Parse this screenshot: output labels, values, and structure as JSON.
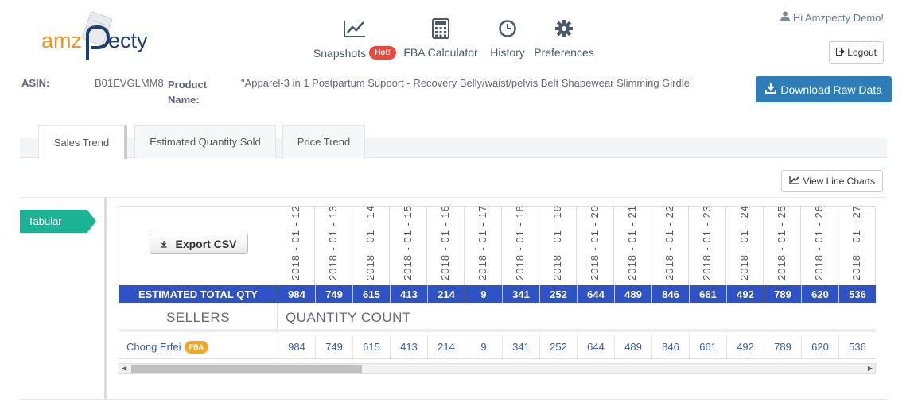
{
  "logo": {
    "text_left": "amz",
    "text_right": "ecty",
    "brand_orange": "#f0921e",
    "brand_navy": "#1c3f6e"
  },
  "nav": [
    {
      "label": "Snapshots",
      "badge": "Hot!",
      "icon": "line-chart-icon"
    },
    {
      "label": "FBA Calculator",
      "icon": "calculator-icon"
    },
    {
      "label": "History",
      "icon": "clock-icon"
    },
    {
      "label": "Preferences",
      "icon": "gear-icon"
    }
  ],
  "user": {
    "greeting": "Hi Amzpecty Demo!",
    "logout_label": "Logout"
  },
  "asin": {
    "label": "ASIN:",
    "value": "B01EVGLMM8",
    "product_name_label": "Product Name:",
    "product_name": "\"Apparel-3 in 1 Postpartum Support - Recovery Belly/waist/pelvis Belt Shapewear Slimming Girdle"
  },
  "download_label": "Download Raw Data",
  "tabs": [
    {
      "label": "Sales Trend",
      "active": true
    },
    {
      "label": "Estimated Quantity Sold",
      "active": false
    },
    {
      "label": "Price Trend",
      "active": false
    }
  ],
  "view_line_charts_label": "View Line Charts",
  "side_tab": "Tabular",
  "table": {
    "export_label": "Export CSV",
    "dates": [
      "2018 - 01 - 12",
      "2018 - 01 - 13",
      "2018 - 01 - 14",
      "2018 - 01 - 15",
      "2018 - 01 - 16",
      "2018 - 01 - 17",
      "2018 - 01 - 18",
      "2018 - 01 - 19",
      "2018 - 01 - 20",
      "2018 - 01 - 21",
      "2018 - 01 - 22",
      "2018 - 01 - 23",
      "2018 - 01 - 24",
      "2018 - 01 - 25",
      "2018 - 01 - 26",
      "2018 - 01 - 27"
    ],
    "total_label": "ESTIMATED TOTAL QTY",
    "totals": [
      "984",
      "749",
      "615",
      "413",
      "214",
      "9",
      "341",
      "252",
      "644",
      "489",
      "846",
      "661",
      "492",
      "789",
      "620",
      "536"
    ],
    "sellers_label": "SELLERS",
    "quantity_label": "QUANTITY COUNT",
    "sellers": [
      {
        "name": "Chong Erfei",
        "badge": "FBA",
        "values": [
          "984",
          "749",
          "615",
          "413",
          "214",
          "9",
          "341",
          "252",
          "644",
          "489",
          "846",
          "661",
          "492",
          "789",
          "620",
          "536"
        ]
      }
    ]
  }
}
